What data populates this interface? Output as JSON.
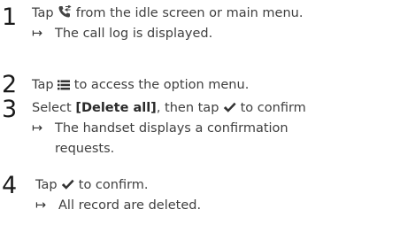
{
  "steps": [
    {
      "number": "1",
      "before_icon": "Tap",
      "icon": "call-log-icon",
      "after_icon": "from the idle screen or main menu.",
      "result": "The call log is displayed."
    },
    {
      "number": "2",
      "before_icon": "Tap",
      "icon": "option-menu-icon",
      "after_icon": "to access the option menu."
    },
    {
      "number": "3",
      "prefix": "Select",
      "keyword": "[Delete all]",
      "middle": ", then tap",
      "icon": "checkmark-icon",
      "after_icon": "to confirm",
      "result_line1": "The handset displays a confirmation",
      "result_line2": "requests."
    },
    {
      "number": "4",
      "before_icon": "Tap",
      "icon": "checkmark-icon",
      "after_icon": "to confirm.",
      "result": "All record are deleted."
    }
  ],
  "result_arrow": "↦"
}
